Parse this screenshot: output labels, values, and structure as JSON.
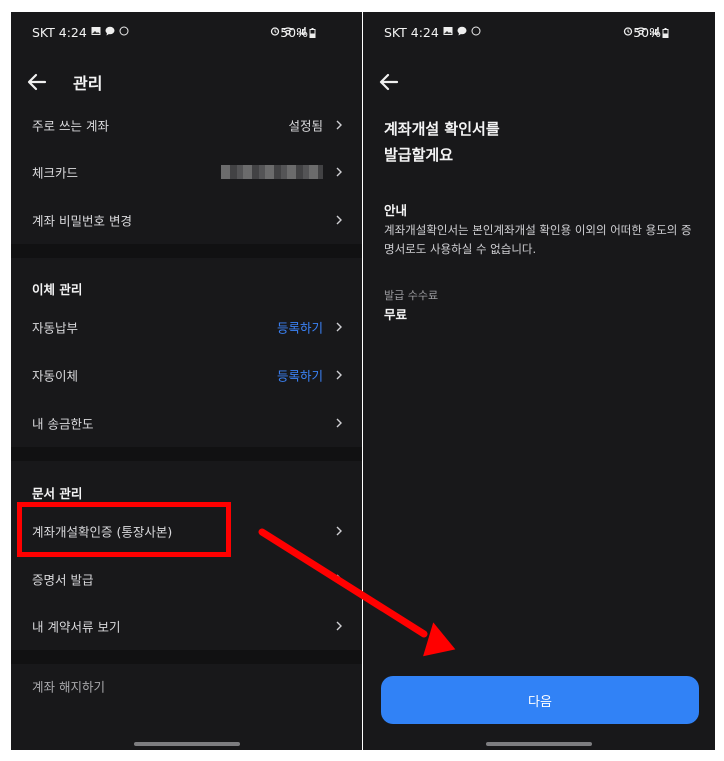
{
  "left": {
    "status": {
      "time": "SKT 4:24",
      "battery": "50%"
    },
    "header": {
      "title": "관리"
    },
    "account": [
      {
        "label": "주로 쓰는 계좌",
        "value": "설정됨"
      },
      {
        "label": "체크카드",
        "value": ""
      },
      {
        "label": "계좌 비밀번호 변경",
        "value": ""
      }
    ],
    "transfer": {
      "title": "이체 관리",
      "items": [
        {
          "label": "자동납부",
          "value": "등록하기"
        },
        {
          "label": "자동이체",
          "value": "등록하기"
        },
        {
          "label": "내 송금한도",
          "value": ""
        }
      ]
    },
    "documents": {
      "title": "문서 관리",
      "items": [
        {
          "label": "계좌개설확인증 (통장사본)"
        },
        {
          "label": "증명서 발급"
        },
        {
          "label": "내 계약서류 보기"
        }
      ]
    },
    "close_account": "계좌 해지하기"
  },
  "right": {
    "status": {
      "time": "SKT 4:24",
      "battery": "50%"
    },
    "title": "계좌개설 확인서를\n발급할게요",
    "notice_title": "안내",
    "notice_text": "계좌개설확인서는 본인계좌개설 확인용 이외의 어떠한 용도의 증명서로도 사용하실 수 없습니다.",
    "fee_label": "발급 수수료",
    "fee_value": "무료",
    "next_button": "다음"
  },
  "colors": {
    "accent": "#3182f6",
    "link": "#3b82f6",
    "highlight": "#ff0000",
    "background": "#18181a"
  },
  "icons": [
    "back-arrow-icon",
    "chevron-right-icon",
    "alarm-icon",
    "wifi-icon",
    "signal-icon",
    "battery-icon",
    "image-icon",
    "message-icon",
    "compass-icon"
  ]
}
